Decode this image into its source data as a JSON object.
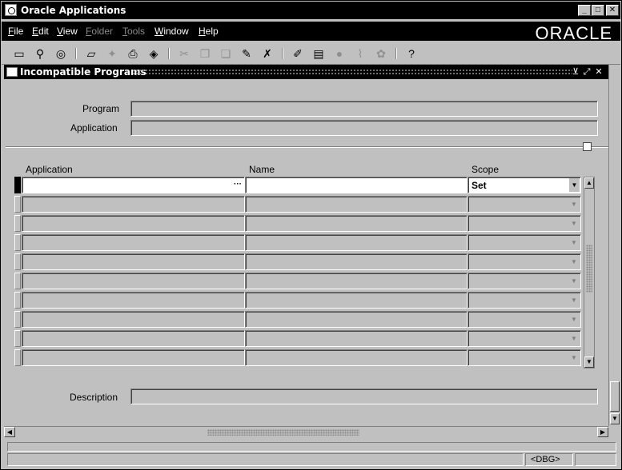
{
  "window": {
    "title": "Oracle Applications",
    "minimize": "_",
    "maximize": "□",
    "close": "✕"
  },
  "menu": [
    {
      "first": "F",
      "rest": "ile",
      "enabled": true
    },
    {
      "first": "E",
      "rest": "dit",
      "enabled": true
    },
    {
      "first": "V",
      "rest": "iew",
      "enabled": true
    },
    {
      "first": "F",
      "rest": "older",
      "enabled": false
    },
    {
      "first": "T",
      "rest": "ools",
      "enabled": false
    },
    {
      "first": "W",
      "rest": "indow",
      "enabled": true
    },
    {
      "first": "H",
      "rest": "elp",
      "enabled": true
    }
  ],
  "brand": "ORACLE",
  "toolbar": {
    "help": "?"
  },
  "form": {
    "title": "Incompatible Programs",
    "program_label": "Program",
    "application_label": "Application",
    "description_label": "Description",
    "columns": {
      "application": "Application",
      "name": "Name",
      "scope": "Scope"
    },
    "rows": [
      {
        "application": "",
        "name": "",
        "scope": "Set"
      },
      {
        "application": "",
        "name": "",
        "scope": ""
      },
      {
        "application": "",
        "name": "",
        "scope": ""
      },
      {
        "application": "",
        "name": "",
        "scope": ""
      },
      {
        "application": "",
        "name": "",
        "scope": ""
      },
      {
        "application": "",
        "name": "",
        "scope": ""
      },
      {
        "application": "",
        "name": "",
        "scope": ""
      },
      {
        "application": "",
        "name": "",
        "scope": ""
      },
      {
        "application": "",
        "name": "",
        "scope": ""
      },
      {
        "application": "",
        "name": "",
        "scope": ""
      }
    ],
    "lov_indicator": "···"
  },
  "status": {
    "message": "",
    "mode": "<DBG>"
  }
}
